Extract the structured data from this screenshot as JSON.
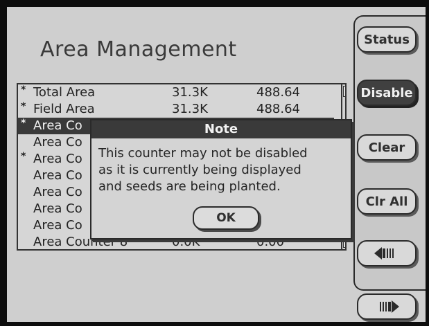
{
  "title": "Area Management",
  "side_buttons": {
    "status": "Status",
    "disable": "Disable",
    "clear": "Clear",
    "clr_all": "Clr All",
    "prev_icon": "arrow-left-icon",
    "next_icon": "arrow-right-icon"
  },
  "list": {
    "rows": [
      {
        "star": "*",
        "name": "Total Area",
        "v1": "31.3K",
        "v2": "488.64"
      },
      {
        "star": "*",
        "name": "Field Area",
        "v1": "31.3K",
        "v2": "488.64"
      },
      {
        "star": "*",
        "name": "Area Co",
        "v1": "",
        "v2": "",
        "selected": true
      },
      {
        "star": "",
        "name": "Area Co",
        "v1": "",
        "v2": ""
      },
      {
        "star": "*",
        "name": "Area Co",
        "v1": "",
        "v2": ""
      },
      {
        "star": "",
        "name": "Area Co",
        "v1": "",
        "v2": ""
      },
      {
        "star": "",
        "name": "Area Co",
        "v1": "",
        "v2": ""
      },
      {
        "star": "",
        "name": "Area Co",
        "v1": "",
        "v2": ""
      },
      {
        "star": "",
        "name": "Area Co",
        "v1": "",
        "v2": ""
      },
      {
        "star": "",
        "name": "Area Counter 8",
        "v1": "0.0K",
        "v2": "0.00"
      }
    ]
  },
  "dialog": {
    "title": "Note",
    "message_line1": "This counter may not be disabled",
    "message_line2": "as it is currently being displayed",
    "message_line3": "and seeds are being planted.",
    "ok_label": "OK"
  }
}
